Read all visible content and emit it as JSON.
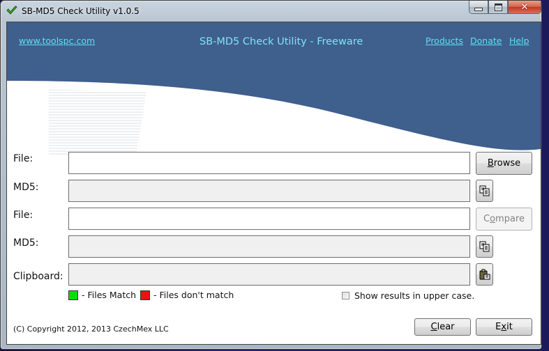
{
  "window": {
    "title": "SB-MD5 Check Utility  v1.0.5",
    "app_icon": "green-checkmark-icon",
    "controls": {
      "minimize": "minimize",
      "maximize": "maximize",
      "close": "close"
    }
  },
  "banner": {
    "site_link": "www.toolspc.com",
    "title": "SB-MD5 Check Utility - Freeware",
    "nav_links": [
      "Products",
      "Donate",
      "Help"
    ],
    "colors": {
      "banner_blue": "#3f5f8c",
      "link_cyan": "#5ee0f0"
    }
  },
  "form": {
    "file1": {
      "label": "File:",
      "value": "",
      "button": {
        "pre": "",
        "accel": "B",
        "post": "rowse"
      }
    },
    "md5_1": {
      "label": "MD5:",
      "value": "",
      "copy_icon": "copy-icon"
    },
    "file2": {
      "label": "File:",
      "value": "",
      "button": {
        "pre": "C",
        "accel": "o",
        "post": "mpare",
        "enabled": false
      }
    },
    "md5_2": {
      "label": "MD5:",
      "value": "",
      "copy_icon": "copy-icon"
    },
    "clipboard": {
      "label": "Clipboard:",
      "value": "",
      "paste_icon": "paste-icon"
    }
  },
  "legend": {
    "match_label": "- Files Match",
    "match_color": "#00e000",
    "nomatch_label": "- Files don't match",
    "nomatch_color": "#ee1111"
  },
  "options": {
    "uppercase_label": "Show results in upper case.",
    "uppercase_checked": false
  },
  "footer": {
    "copyright": "(C) Copyright 2012, 2013 CzechMex LLC",
    "clear_button": {
      "pre": "",
      "accel": "C",
      "post": "lear"
    },
    "exit_button": {
      "pre": "E",
      "accel": "x",
      "post": "it"
    }
  }
}
